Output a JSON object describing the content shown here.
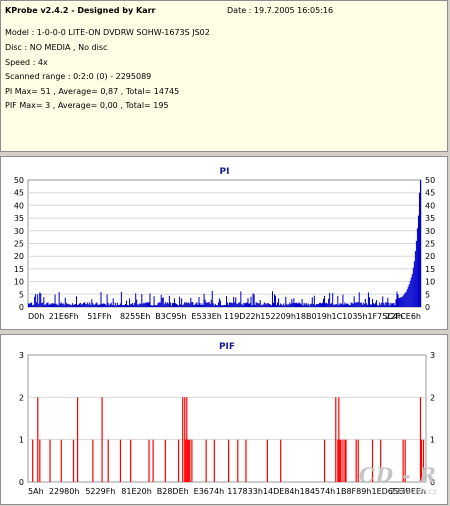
{
  "info": {
    "title": "KProbe v2.4.2 - Designed by Karr",
    "date": "Date : 19.7.2005 16:05:16",
    "model": "Model : 1-0-0-0 LITE-ON DVDRW SOHW-1673S JS02",
    "disc": "Disc : NO MEDIA , No disc",
    "speed": "Speed : 4x",
    "scanned_range": "Scanned range : 0:2:0 (0) - 2295089",
    "pi_summary": "PI Max= 51 , Average= 0,87 , Total= 14745",
    "pif_summary": "PIF Max= 3 , Average= 0,00 , Total= 195"
  },
  "watermark": {
    "main": "CD - R",
    "url": "www.cdr.cz"
  },
  "chart_data": [
    {
      "type": "bar",
      "title": "PI",
      "ylim": [
        0,
        50
      ],
      "y_ticks": [
        0,
        5,
        10,
        15,
        20,
        25,
        30,
        35,
        40,
        45,
        50
      ],
      "x_tick_labels": [
        "D0h",
        "21E6Fh",
        "51FFh",
        "8255Eh",
        "B3C95h",
        "E533Eh",
        "119D22h",
        "152209h",
        "18B019h",
        "1C1035h",
        "1F75C4h",
        "22FCE6h"
      ],
      "grid": true,
      "color": "#0000cc",
      "bin_count": 385,
      "baseline_level": 1.5,
      "typical_spike": 5,
      "max": 51,
      "average": 0.87,
      "total": 14745,
      "end_ramp": [
        {
          "bin": 360,
          "value": 3
        },
        {
          "bin": 366,
          "value": 4
        },
        {
          "bin": 370,
          "value": 6
        },
        {
          "bin": 373,
          "value": 9
        },
        {
          "bin": 376,
          "value": 13
        },
        {
          "bin": 378,
          "value": 18
        },
        {
          "bin": 380,
          "value": 26
        },
        {
          "bin": 382,
          "value": 36
        },
        {
          "bin": 383,
          "value": 45
        },
        {
          "bin": 384,
          "value": 50
        }
      ]
    },
    {
      "type": "bar",
      "title": "PIF",
      "ylim": [
        0,
        3
      ],
      "y_ticks": [
        0,
        1,
        2,
        3
      ],
      "x_tick_labels": [
        "5Ah",
        "22980h",
        "5229Fh",
        "81E20h",
        "B28DEh",
        "E3674h",
        "117833h",
        "14DE84h",
        "184574h",
        "1B8F89h",
        "1ED656h",
        "223BEEh"
      ],
      "grid": true,
      "color": "#ff0000",
      "bin_count": 390,
      "max": 3,
      "average": 0.0,
      "total": 195,
      "bars": [
        {
          "bin": 4,
          "value": 1
        },
        {
          "bin": 9,
          "value": 2
        },
        {
          "bin": 11,
          "value": 1
        },
        {
          "bin": 21,
          "value": 1
        },
        {
          "bin": 32,
          "value": 1
        },
        {
          "bin": 44,
          "value": 1
        },
        {
          "bin": 48,
          "value": 2
        },
        {
          "bin": 63,
          "value": 1
        },
        {
          "bin": 72,
          "value": 2
        },
        {
          "bin": 78,
          "value": 1
        },
        {
          "bin": 90,
          "value": 1
        },
        {
          "bin": 100,
          "value": 1
        },
        {
          "bin": 118,
          "value": 1
        },
        {
          "bin": 122,
          "value": 1
        },
        {
          "bin": 134,
          "value": 1
        },
        {
          "bin": 147,
          "value": 1
        },
        {
          "bin": 151,
          "value": 2
        },
        {
          "bin": 153,
          "value": 2
        },
        {
          "bin": 154,
          "value": 1
        },
        {
          "bin": 155,
          "value": 2
        },
        {
          "bin": 156,
          "value": 1
        },
        {
          "bin": 157,
          "value": 1
        },
        {
          "bin": 158,
          "value": 1
        },
        {
          "bin": 160,
          "value": 1
        },
        {
          "bin": 174,
          "value": 1
        },
        {
          "bin": 182,
          "value": 1
        },
        {
          "bin": 196,
          "value": 1
        },
        {
          "bin": 205,
          "value": 1
        },
        {
          "bin": 213,
          "value": 1
        },
        {
          "bin": 234,
          "value": 1
        },
        {
          "bin": 247,
          "value": 1
        },
        {
          "bin": 290,
          "value": 1
        },
        {
          "bin": 301,
          "value": 2
        },
        {
          "bin": 303,
          "value": 1
        },
        {
          "bin": 304,
          "value": 2
        },
        {
          "bin": 305,
          "value": 1
        },
        {
          "bin": 306,
          "value": 1
        },
        {
          "bin": 308,
          "value": 1
        },
        {
          "bin": 310,
          "value": 1
        },
        {
          "bin": 311,
          "value": 1
        },
        {
          "bin": 321,
          "value": 1
        },
        {
          "bin": 323,
          "value": 1
        },
        {
          "bin": 337,
          "value": 1
        },
        {
          "bin": 345,
          "value": 1
        },
        {
          "bin": 367,
          "value": 1
        },
        {
          "bin": 369,
          "value": 1
        },
        {
          "bin": 384,
          "value": 2
        },
        {
          "bin": 385,
          "value": 1
        },
        {
          "bin": 387,
          "value": 1
        }
      ]
    }
  ]
}
